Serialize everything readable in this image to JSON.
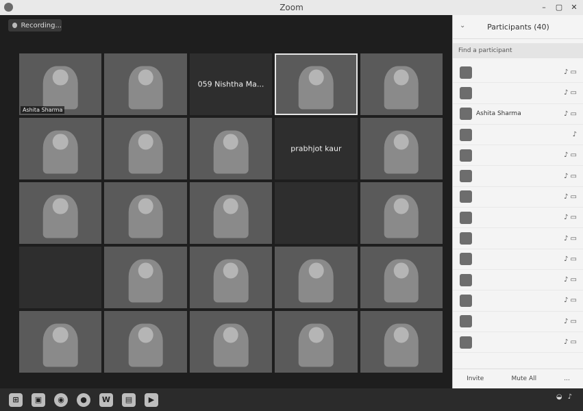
{
  "window": {
    "title": "Zoom",
    "controls": [
      "–",
      "▢",
      "✕"
    ]
  },
  "meeting": {
    "recording_label": "Recording..."
  },
  "tiles": [
    {
      "name": "Ashita Sharma",
      "center_name": "",
      "dark": false,
      "active": false
    },
    {
      "name": "",
      "center_name": "",
      "dark": false,
      "active": false
    },
    {
      "name": "",
      "center_name": "059 Nishtha Ma...",
      "dark": true,
      "active": false
    },
    {
      "name": "",
      "center_name": "",
      "dark": false,
      "active": true
    },
    {
      "name": "",
      "center_name": "",
      "dark": false,
      "active": false
    },
    {
      "name": "",
      "center_name": "",
      "dark": false,
      "active": false
    },
    {
      "name": "",
      "center_name": "",
      "dark": false,
      "active": false
    },
    {
      "name": "",
      "center_name": "",
      "dark": false,
      "active": false
    },
    {
      "name": "",
      "center_name": "prabhjot kaur",
      "dark": true,
      "active": false
    },
    {
      "name": "",
      "center_name": "",
      "dark": false,
      "active": false
    },
    {
      "name": "",
      "center_name": "",
      "dark": false,
      "active": false
    },
    {
      "name": "",
      "center_name": "",
      "dark": false,
      "active": false
    },
    {
      "name": "",
      "center_name": "",
      "dark": false,
      "active": false
    },
    {
      "name": "",
      "center_name": "",
      "dark": true,
      "active": false
    },
    {
      "name": "",
      "center_name": "",
      "dark": false,
      "active": false
    },
    {
      "name": "",
      "center_name": "",
      "dark": true,
      "active": false
    },
    {
      "name": "",
      "center_name": "",
      "dark": false,
      "active": false
    },
    {
      "name": "",
      "center_name": "",
      "dark": false,
      "active": false
    },
    {
      "name": "",
      "center_name": "",
      "dark": false,
      "active": false
    },
    {
      "name": "",
      "center_name": "",
      "dark": false,
      "active": false
    },
    {
      "name": "",
      "center_name": "",
      "dark": false,
      "active": false
    },
    {
      "name": "",
      "center_name": "",
      "dark": false,
      "active": false
    },
    {
      "name": "",
      "center_name": "",
      "dark": false,
      "active": false
    },
    {
      "name": "",
      "center_name": "",
      "dark": false,
      "active": false
    },
    {
      "name": "",
      "center_name": "",
      "dark": false,
      "active": false
    }
  ],
  "participants_panel": {
    "title": "Participants (40)",
    "invite_label": "Find a participant",
    "participants": [
      {
        "name": "",
        "icons": "♪ ▭"
      },
      {
        "name": "",
        "icons": "♪ ▭"
      },
      {
        "name": "Ashita Sharma",
        "icons": "♪ ▭"
      },
      {
        "name": "",
        "icons": "♪"
      },
      {
        "name": "",
        "icons": "♪ ▭"
      },
      {
        "name": "",
        "icons": "♪ ▭"
      },
      {
        "name": "",
        "icons": "♪ ▭"
      },
      {
        "name": "",
        "icons": "♪ ▭"
      },
      {
        "name": "",
        "icons": "♪ ▭"
      },
      {
        "name": "",
        "icons": "♪ ▭"
      },
      {
        "name": "",
        "icons": "♪ ▭"
      },
      {
        "name": "",
        "icons": "♪ ▭"
      },
      {
        "name": "",
        "icons": "♪ ▭"
      },
      {
        "name": "",
        "icons": "♪ ▭"
      }
    ],
    "footer": {
      "invite": "Invite",
      "mute_all": "Mute All",
      "more": "..."
    }
  },
  "taskbar": {
    "icons": [
      "start-icon",
      "search-icon",
      "chrome-icon",
      "media-icon",
      "word-icon",
      "folder-icon",
      "zoom-icon"
    ],
    "word_label": "W",
    "tray_time": ""
  }
}
